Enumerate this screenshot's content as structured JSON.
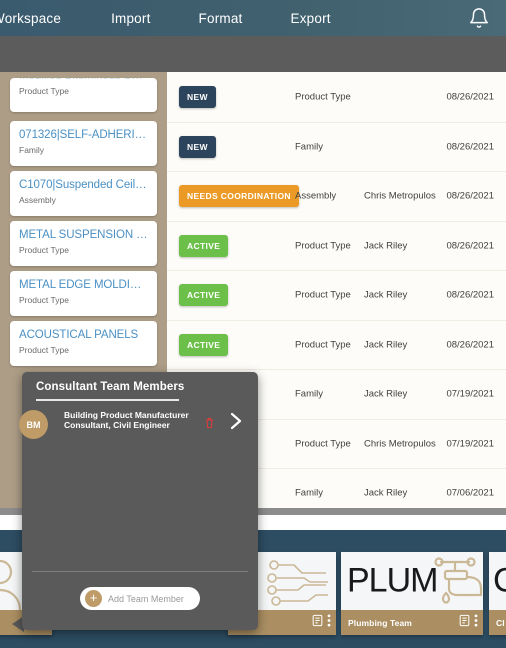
{
  "topnav": {
    "items": [
      {
        "label": "Workspace",
        "id": "workspace"
      },
      {
        "label": "Import",
        "id": "import"
      },
      {
        "label": "Format",
        "id": "format"
      },
      {
        "label": "Export",
        "id": "export"
      }
    ],
    "bell_icon": "notification-bell-icon",
    "background_color": "#3a5a6e"
  },
  "left_list": {
    "cards": [
      {
        "title": "Modified Bituminous Shi...",
        "subtitle": "Product Type"
      },
      {
        "title": "071326|SELF-ADHERIN...",
        "subtitle": "Family"
      },
      {
        "title": "C1070|Suspended Ceilin...",
        "subtitle": "Assembly"
      },
      {
        "title": "METAL SUSPENSION SY...",
        "subtitle": "Product Type"
      },
      {
        "title": "METAL EDGE MOLDING...",
        "subtitle": "Product Type"
      },
      {
        "title": "ACOUSTICAL PANELS",
        "subtitle": "Product Type"
      }
    ]
  },
  "table": {
    "rows": [
      {
        "status": "NEW",
        "status_color": "#2d455c",
        "type": "Product Type",
        "owner": "",
        "date": "08/26/2021"
      },
      {
        "status": "NEW",
        "status_color": "#2d455c",
        "type": "Family",
        "owner": "",
        "date": "08/26/2021"
      },
      {
        "status": "NEEDS COORDINATION",
        "status_color": "#eb9b25",
        "type": "Assembly",
        "owner": "Chris Metropulos",
        "date": "08/26/2021"
      },
      {
        "status": "ACTIVE",
        "status_color": "#6cc04a",
        "type": "Product Type",
        "owner": "Jack Riley",
        "date": "08/26/2021"
      },
      {
        "status": "ACTIVE",
        "status_color": "#6cc04a",
        "type": "Product Type",
        "owner": "Jack Riley",
        "date": "08/26/2021"
      },
      {
        "status": "ACTIVE",
        "status_color": "#6cc04a",
        "type": "Product Type",
        "owner": "Jack Riley",
        "date": "08/26/2021"
      },
      {
        "status": "",
        "status_color": "",
        "type": "Family",
        "owner": "Jack Riley",
        "date": "07/19/2021"
      },
      {
        "status": "",
        "status_color": "",
        "type": "Product Type",
        "owner": "Chris Metropulos",
        "date": "07/19/2021"
      },
      {
        "status": "",
        "status_color": "",
        "type": "Family",
        "owner": "Jack Riley",
        "date": "07/06/2021"
      }
    ]
  },
  "popup": {
    "title": "Consultant Team Members",
    "member": {
      "initials": "BM",
      "name": "Building Product Manufacturer",
      "role": "Consultant, Civil Engineer",
      "delete_icon": "trash-icon",
      "expand_icon": "chevron-right-icon",
      "avatar_color": "#bf9b67"
    },
    "add_button_label": "Add Team Member",
    "add_button_icon": "plus-circle-icon",
    "background_color": "#5a5a5a"
  },
  "team_cards": [
    {
      "word": "",
      "footer": "",
      "art": "person-icon",
      "partial": true
    },
    {
      "word": "C",
      "footer": "",
      "art": "circuit-icon",
      "partial": true
    },
    {
      "word": "PLUM",
      "footer": "Plumbing Team",
      "art": "faucet-icon",
      "partial": false
    },
    {
      "word": "C",
      "footer": "CI",
      "art": "",
      "partial": true
    }
  ],
  "card_footer_icons": {
    "note_icon": "document-note-icon",
    "menu_icon": "kebab-menu-icon"
  }
}
